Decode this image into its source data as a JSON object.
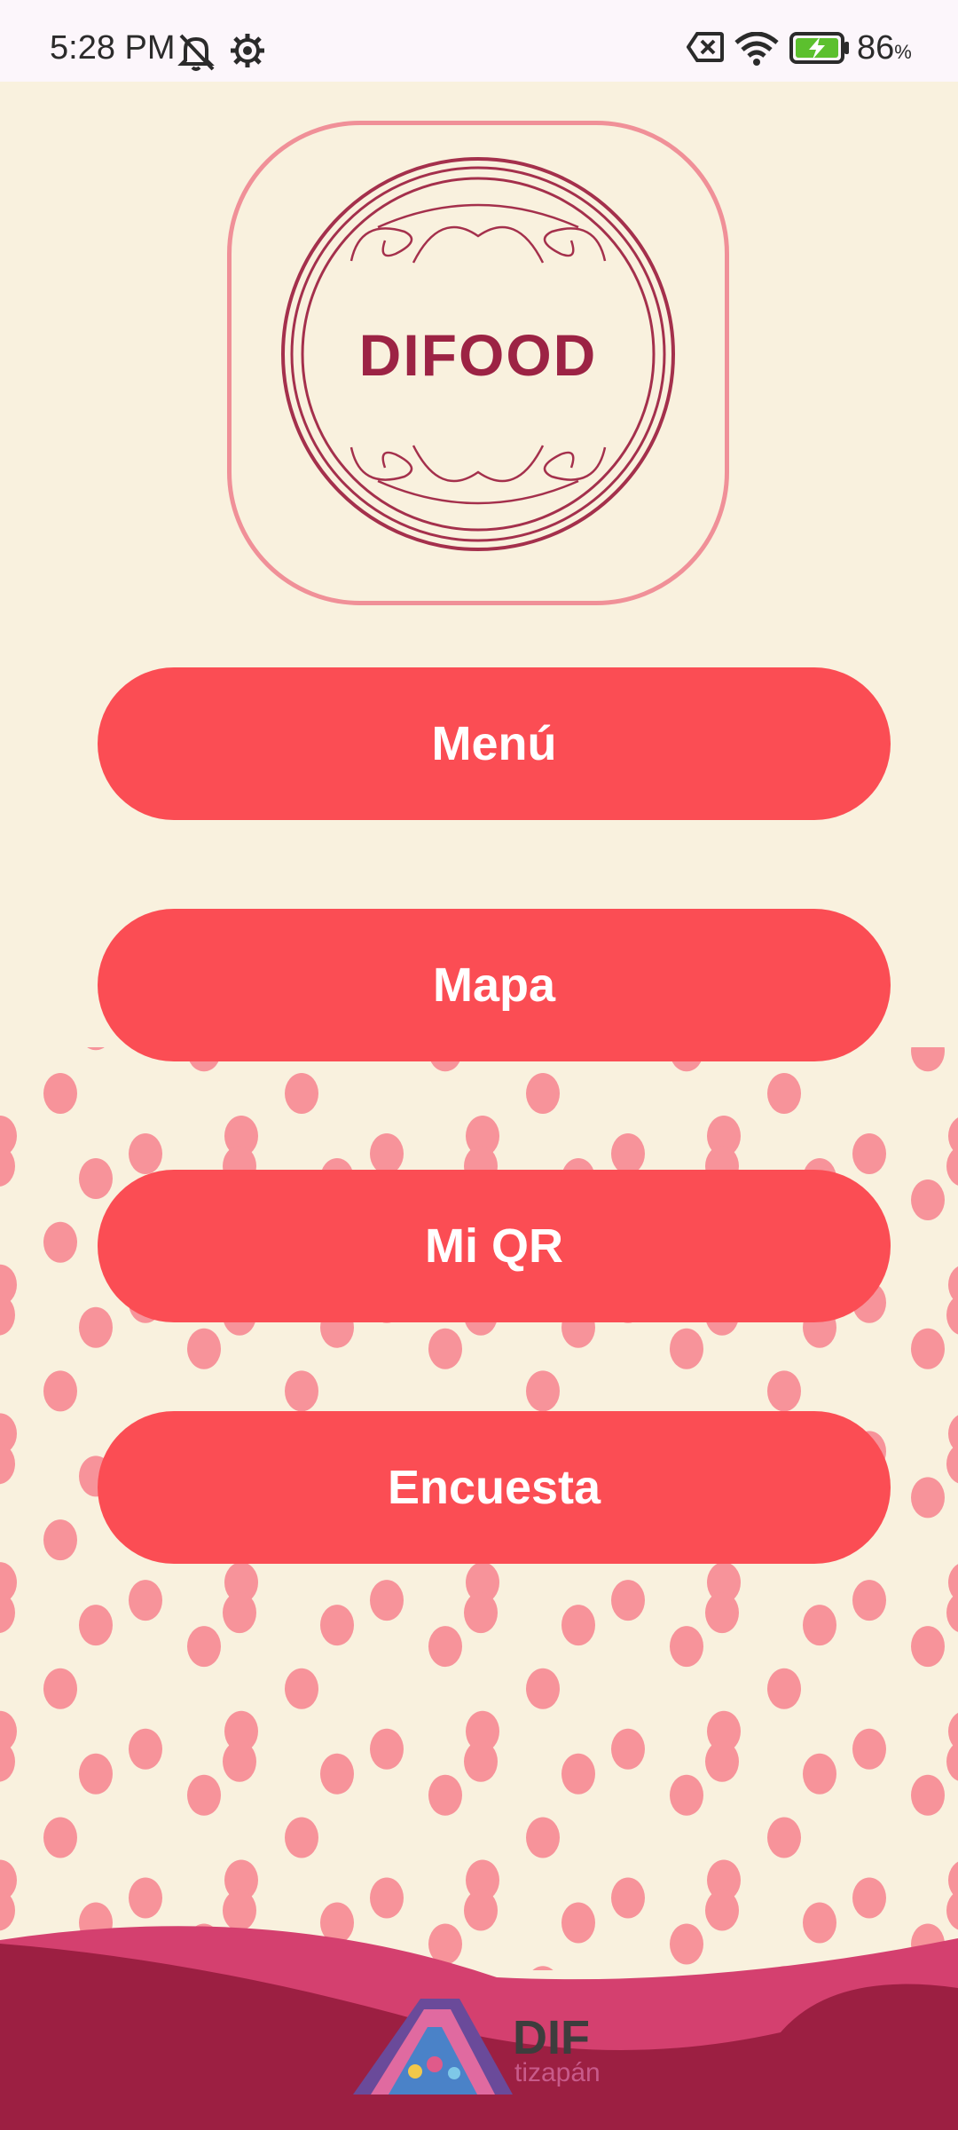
{
  "status_bar": {
    "time": "5:28 PM",
    "battery_percent": "86",
    "battery_unit": "%",
    "icons": [
      "mute-bell-icon",
      "settings-gear-icon",
      "no-sim-icon",
      "wifi-icon",
      "battery-charging-icon"
    ]
  },
  "logo": {
    "text": "DIFOOD"
  },
  "menu": {
    "buttons": [
      {
        "label": "Menú"
      },
      {
        "label": "Mapa"
      },
      {
        "label": "Mi QR"
      },
      {
        "label": "Encuesta"
      }
    ]
  },
  "footer": {
    "brand": "DIF",
    "subbrand": "tizapán"
  },
  "colors": {
    "background": "#f9f1de",
    "button": "#fb4d54",
    "dots": "#f7939a",
    "wave_dark": "#9c1f42",
    "wave_light": "#d4406f"
  }
}
